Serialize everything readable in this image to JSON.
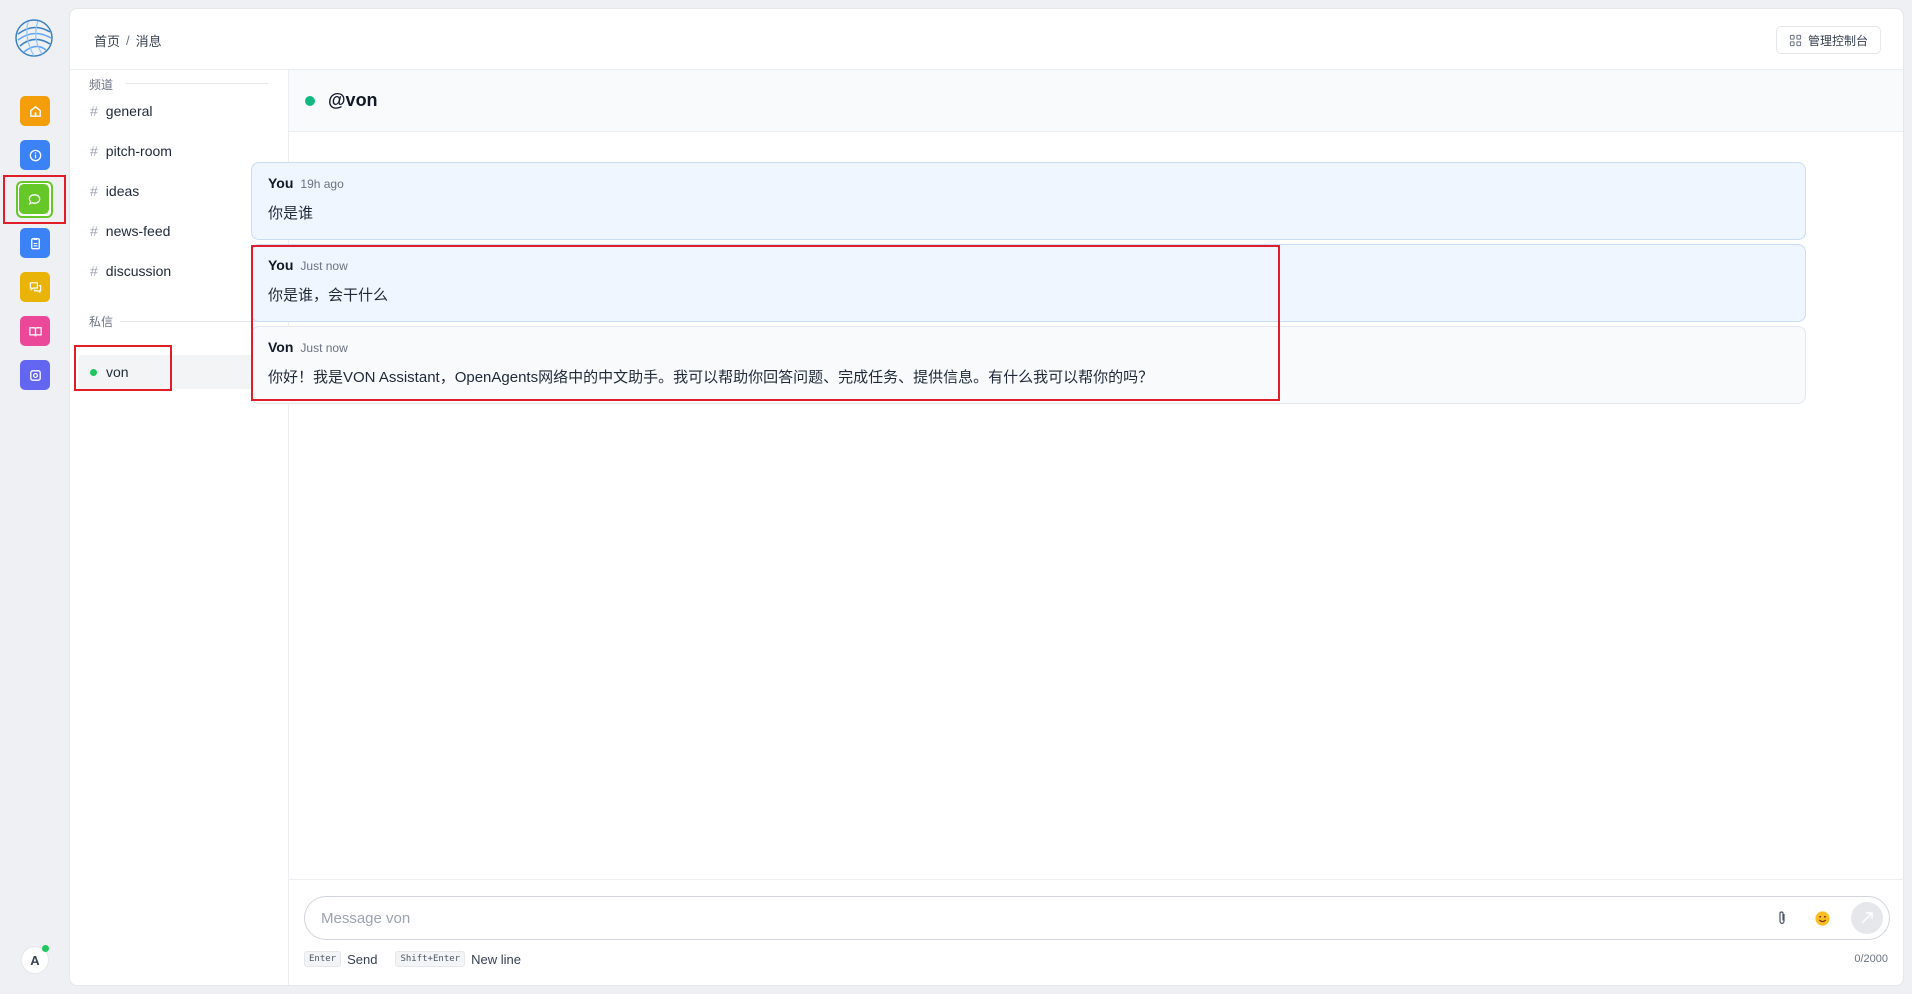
{
  "breadcrumb": {
    "home": "首页",
    "separator": "/",
    "current": "消息"
  },
  "admin_button": {
    "label": "管理控制台",
    "icon": "grid-icon"
  },
  "rail": {
    "items": [
      {
        "name": "home-icon",
        "color": "#f59e0b"
      },
      {
        "name": "info-icon",
        "color": "#3b82f6"
      },
      {
        "name": "chat-icon",
        "color": "#65c828",
        "active": true
      },
      {
        "name": "clipboard-icon",
        "color": "#3b82f6"
      },
      {
        "name": "discussion-icon",
        "color": "#eab308"
      },
      {
        "name": "book-icon",
        "color": "#ec4899"
      },
      {
        "name": "settings-icon",
        "color": "#6366f1"
      }
    ],
    "avatar_initial": "A"
  },
  "sidebar": {
    "channels_label": "频道",
    "channels": [
      "general",
      "pitch-room",
      "ideas",
      "news-feed",
      "discussion"
    ],
    "dm_label": "私信",
    "dms": [
      {
        "name": "von",
        "online": true
      }
    ]
  },
  "chat": {
    "title": "@von",
    "messages": [
      {
        "author": "You",
        "time": "19h ago",
        "text": "你是谁"
      },
      {
        "author": "You",
        "time": "Just now",
        "text": "你是谁，会干什么"
      },
      {
        "author": "Von",
        "time": "Just now",
        "text": "你好！我是VON Assistant，OpenAgents网络中的中文助手。我可以帮助你回答问题、完成任务、提供信息。有什么我可以帮你的吗？"
      }
    ]
  },
  "composer": {
    "placeholder": "Message von",
    "hint_enter_key": "Enter",
    "hint_enter_label": "Send",
    "hint_shift_key": "Shift+Enter",
    "hint_shift_label": "New line",
    "counter": "0/2000"
  }
}
